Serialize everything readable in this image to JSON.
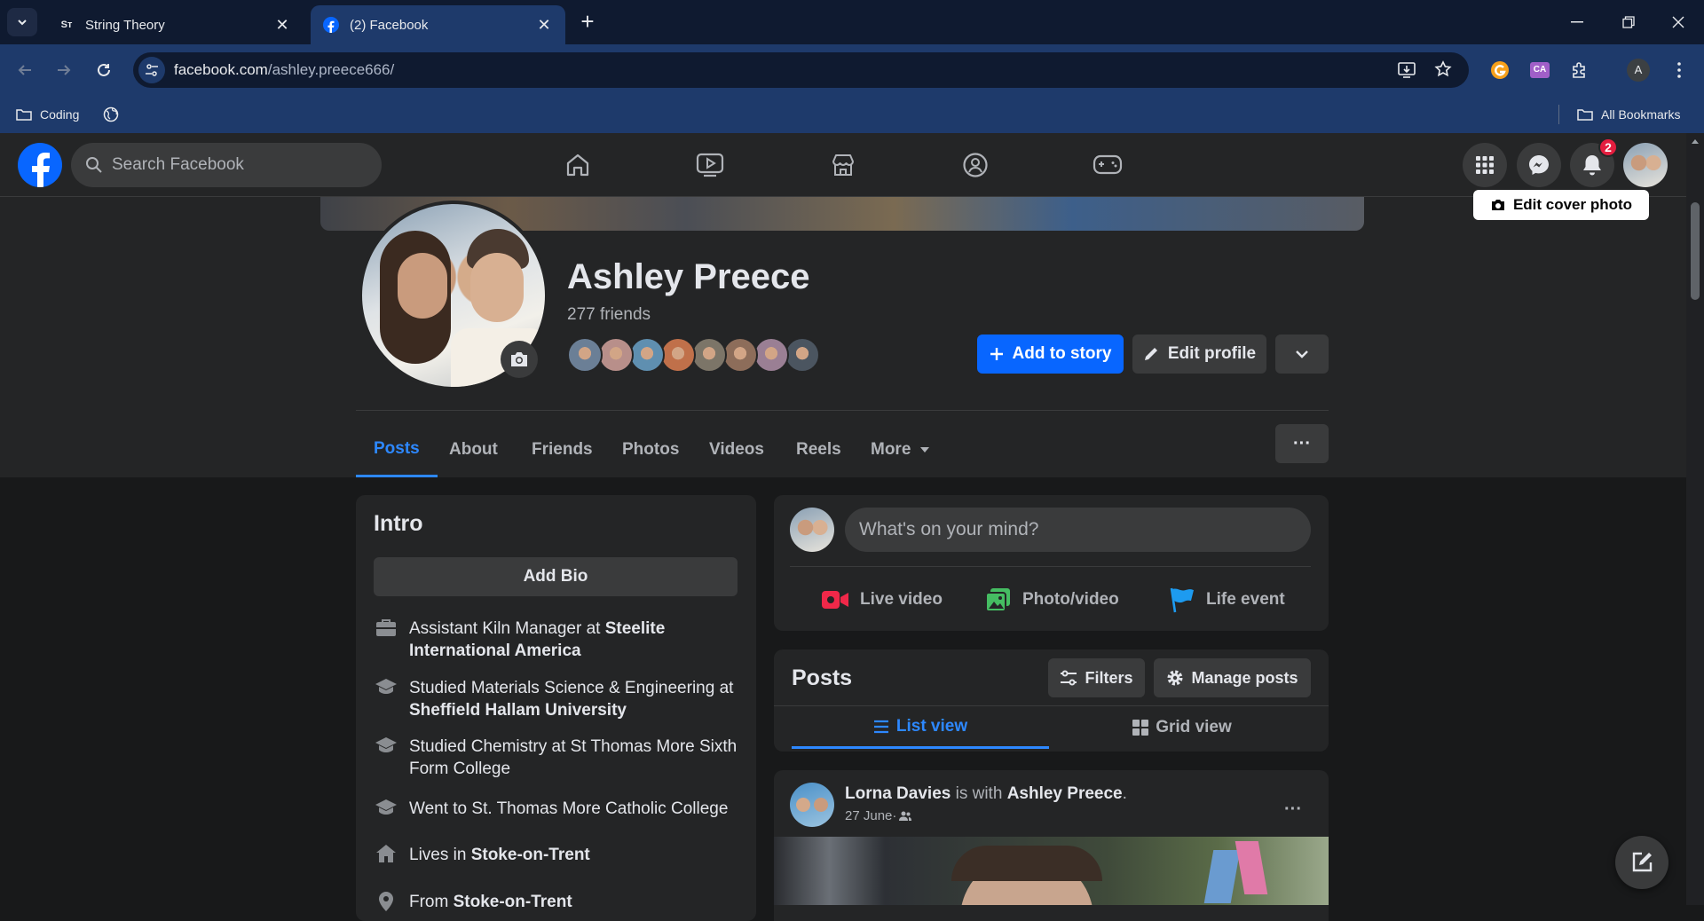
{
  "browser": {
    "tabs": [
      {
        "title": "String Theory",
        "favicon": "string-theory-icon"
      },
      {
        "title": "(2) Facebook",
        "favicon": "facebook-icon"
      }
    ],
    "url_host": "facebook.com",
    "url_path": "/ashley.preece666/",
    "bookmarks": [
      {
        "label": "Coding"
      }
    ],
    "all_bookmarks_label": "All Bookmarks",
    "profile_initial": "A",
    "extensions": [
      "grammarly-icon",
      "ca-icon",
      "puzzle-icon"
    ],
    "ca_label": "CA"
  },
  "fb_header": {
    "search_placeholder": "Search Facebook",
    "notification_count": "2",
    "nav": [
      "home-icon",
      "watch-icon",
      "marketplace-icon",
      "groups-icon",
      "gaming-icon"
    ]
  },
  "profile": {
    "edit_cover_label": "Edit cover photo",
    "name": "Ashley Preece",
    "friends_count": "277 friends",
    "add_story_label": "Add to story",
    "edit_profile_label": "Edit profile",
    "tabs": [
      "Posts",
      "About",
      "Friends",
      "Photos",
      "Videos",
      "Reels",
      "More"
    ],
    "more_options": "···",
    "friend_faces": [
      "#6b7f96",
      "#b88f8a",
      "#5f8fb0",
      "#c0704a",
      "#7c7568",
      "#8d6d5a",
      "#9a7f94",
      "#4b5560"
    ]
  },
  "intro": {
    "title": "Intro",
    "add_bio_label": "Add Bio",
    "items": [
      {
        "icon": "briefcase-icon",
        "prefix": "Assistant Kiln Manager at ",
        "bold": "Steelite International America"
      },
      {
        "icon": "graduation-cap-icon",
        "prefix": "Studied Materials Science & Engineering at ",
        "bold": "Sheffield Hallam University"
      },
      {
        "icon": "graduation-cap-icon",
        "prefix": "Studied Chemistry at St Thomas More Sixth Form College",
        "bold": ""
      },
      {
        "icon": "graduation-cap-icon",
        "prefix": "Went to St. Thomas More Catholic College",
        "bold": ""
      },
      {
        "icon": "home-icon",
        "prefix": "Lives in ",
        "bold": "Stoke-on-Trent"
      },
      {
        "icon": "location-pin-icon",
        "prefix": "From ",
        "bold": "Stoke-on-Trent"
      }
    ]
  },
  "composer": {
    "placeholder": "What's on your mind?",
    "live_label": "Live video",
    "photo_label": "Photo/video",
    "life_label": "Life event"
  },
  "posts": {
    "title": "Posts",
    "filters_label": "Filters",
    "manage_label": "Manage posts",
    "list_view_label": "List view",
    "grid_view_label": "Grid view"
  },
  "post": {
    "author": "Lorna Davies",
    "with_text": " is with ",
    "tagged": "Ashley Preece",
    "period": ".",
    "date": "27 June",
    "dot": " · ",
    "audience_icon": "friends-icon",
    "options": "···"
  },
  "colors": {
    "accent": "#0866ff",
    "link": "#2d88ff",
    "bg": "#18191a",
    "card": "#242526"
  }
}
